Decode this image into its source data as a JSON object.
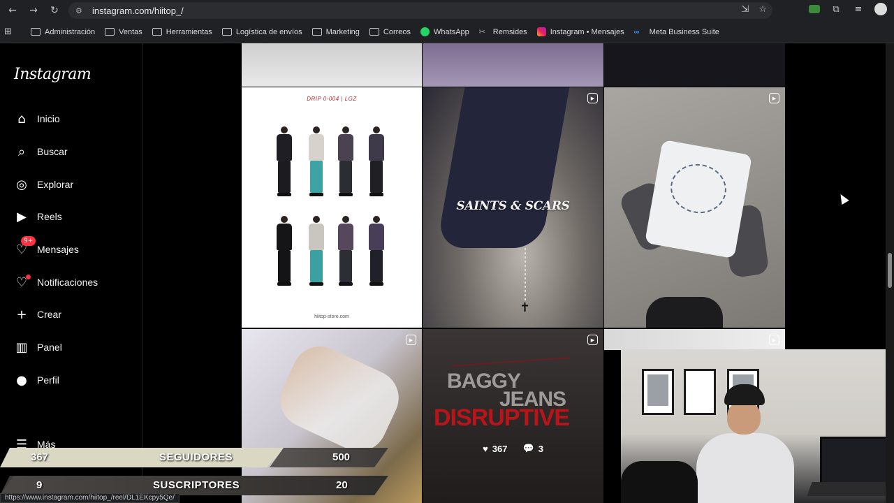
{
  "browser": {
    "url": "instagram.com/hiitop_/",
    "bookmarks": [
      {
        "label": "Administración",
        "icon": "folder"
      },
      {
        "label": "Ventas",
        "icon": "folder"
      },
      {
        "label": "Herramientas",
        "icon": "folder"
      },
      {
        "label": "Logística de envíos",
        "icon": "folder"
      },
      {
        "label": "Marketing",
        "icon": "folder"
      },
      {
        "label": "Correos",
        "icon": "folder"
      },
      {
        "label": "WhatsApp",
        "icon": "whatsapp"
      },
      {
        "label": "Remsides",
        "icon": "remsides"
      },
      {
        "label": "Instagram • Mensajes",
        "icon": "instagram"
      },
      {
        "label": "Meta Business Suite",
        "icon": "meta"
      }
    ],
    "status_url": "https://www.instagram.com/hiitop_/reel/DL1EKcpy5Qe/"
  },
  "sidebar": {
    "logo": "Instagram",
    "items": [
      {
        "label": "Inicio",
        "icon": "home-icon"
      },
      {
        "label": "Buscar",
        "icon": "search-icon"
      },
      {
        "label": "Explorar",
        "icon": "compass-icon"
      },
      {
        "label": "Reels",
        "icon": "reels-icon"
      },
      {
        "label": "Mensajes",
        "icon": "messenger-icon",
        "badge": "9+"
      },
      {
        "label": "Notificaciones",
        "icon": "heart-icon"
      },
      {
        "label": "Crear",
        "icon": "plus-icon"
      },
      {
        "label": "Panel",
        "icon": "chart-icon"
      },
      {
        "label": "Perfil",
        "icon": "profile-icon"
      },
      {
        "label": "Más",
        "icon": "menu-icon"
      }
    ]
  },
  "grid": {
    "drop_title": "DRIP 0-004 | LGZ",
    "drop_footer": "hiitop-store.com",
    "saints_text": "SAINTS & SCARS",
    "baggy_line1": "BAGGY",
    "baggy_line2": "JEANS",
    "baggy_line3": "DISRUPTIVE",
    "likes": "367",
    "comments": "3"
  },
  "overlay": {
    "row1": {
      "left_num": "367",
      "label": "SEGUIDORES",
      "right_num": "500"
    },
    "row2": {
      "left_num": "9",
      "label": "SUSCRIPTORES",
      "right_num": "20"
    }
  }
}
